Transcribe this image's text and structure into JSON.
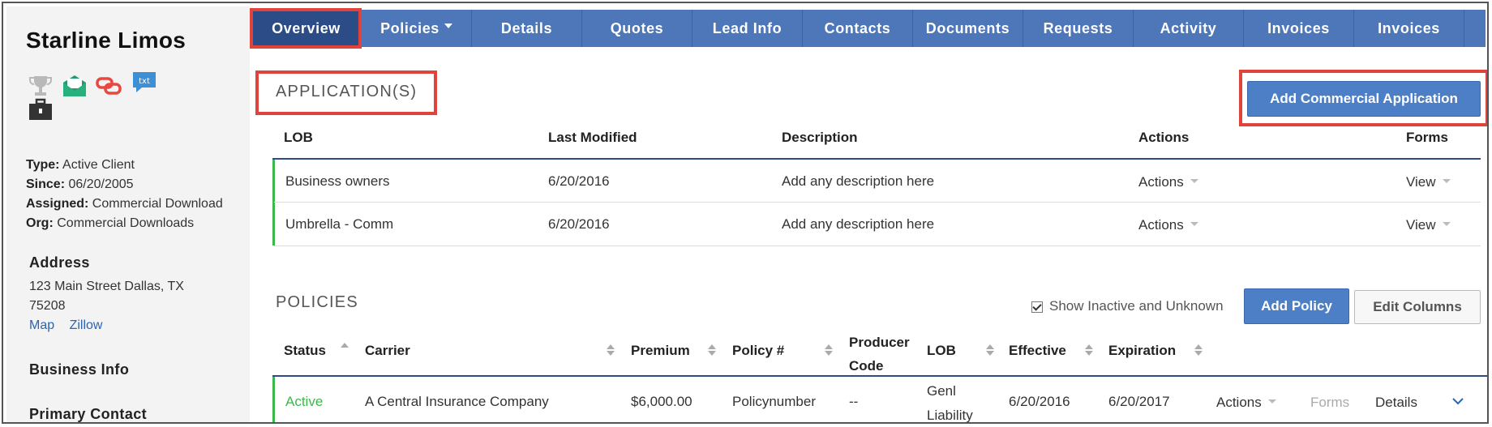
{
  "client": {
    "name": "Starline Limos",
    "type_label": "Type:",
    "type_value": "Active Client",
    "since_label": "Since:",
    "since_value": "06/20/2005",
    "assigned_label": "Assigned:",
    "assigned_value": "Commercial Download",
    "org_label": "Org:",
    "org_value": "Commercial Downloads"
  },
  "icons": [
    "trophy-icon",
    "envelope-icon",
    "link-icon",
    "txt-message-icon",
    "briefcase-icon"
  ],
  "icon_text": {
    "txt": "txt"
  },
  "address": {
    "title": "Address",
    "line1": "123 Main Street Dallas, TX",
    "line2": "75208",
    "map_link": "Map",
    "zillow_link": "Zillow"
  },
  "sections": {
    "business_info": "Business Info",
    "primary_contact": "Primary Contact"
  },
  "nav": {
    "tabs": [
      {
        "label": "Overview",
        "active": true
      },
      {
        "label": "Policies",
        "dropdown": true
      },
      {
        "label": "Details"
      },
      {
        "label": "Quotes"
      },
      {
        "label": "Lead Info"
      },
      {
        "label": "Contacts"
      },
      {
        "label": "Documents"
      },
      {
        "label": "Requests"
      },
      {
        "label": "Activity"
      },
      {
        "label": "Invoices"
      },
      {
        "label": "Invoices"
      }
    ]
  },
  "applications": {
    "title": "APPLICATION(S)",
    "add_button": "Add Commercial Application",
    "columns": [
      "LOB",
      "Last Modified",
      "Description",
      "Actions",
      "Forms"
    ],
    "rows": [
      {
        "lob": "Business owners",
        "modified": "6/20/2016",
        "description": "Add any description here",
        "actions": "Actions",
        "forms": "View"
      },
      {
        "lob": "Umbrella - Comm",
        "modified": "6/20/2016",
        "description": "Add any description here",
        "actions": "Actions",
        "forms": "View"
      }
    ]
  },
  "policies": {
    "title": "POLICIES",
    "show_inactive": "Show Inactive and Unknown",
    "show_inactive_checked": true,
    "add_button": "Add Policy",
    "edit_columns_button": "Edit Columns",
    "columns": {
      "status": "Status",
      "carrier": "Carrier",
      "premium": "Premium",
      "policy": "Policy #",
      "producer_1": "Producer",
      "producer_2": "Code",
      "lob": "LOB",
      "effective": "Effective",
      "expiration": "Expiration"
    },
    "rows": [
      {
        "status": "Active",
        "carrier": "A Central Insurance Company",
        "premium": "$6,000.00",
        "policy": "Policynumber",
        "producer": "--",
        "lob_1": "Genl",
        "lob_2": "Liability",
        "effective": "6/20/2016",
        "expiration": "6/20/2017",
        "actions": "Actions",
        "forms": "Forms",
        "details": "Details"
      }
    ]
  },
  "colors": {
    "nav": "#4d77b8",
    "nav_active": "#2b4c86",
    "link": "#2a64b4",
    "active_status": "#3cb84a",
    "highlight": "#e0423c"
  }
}
